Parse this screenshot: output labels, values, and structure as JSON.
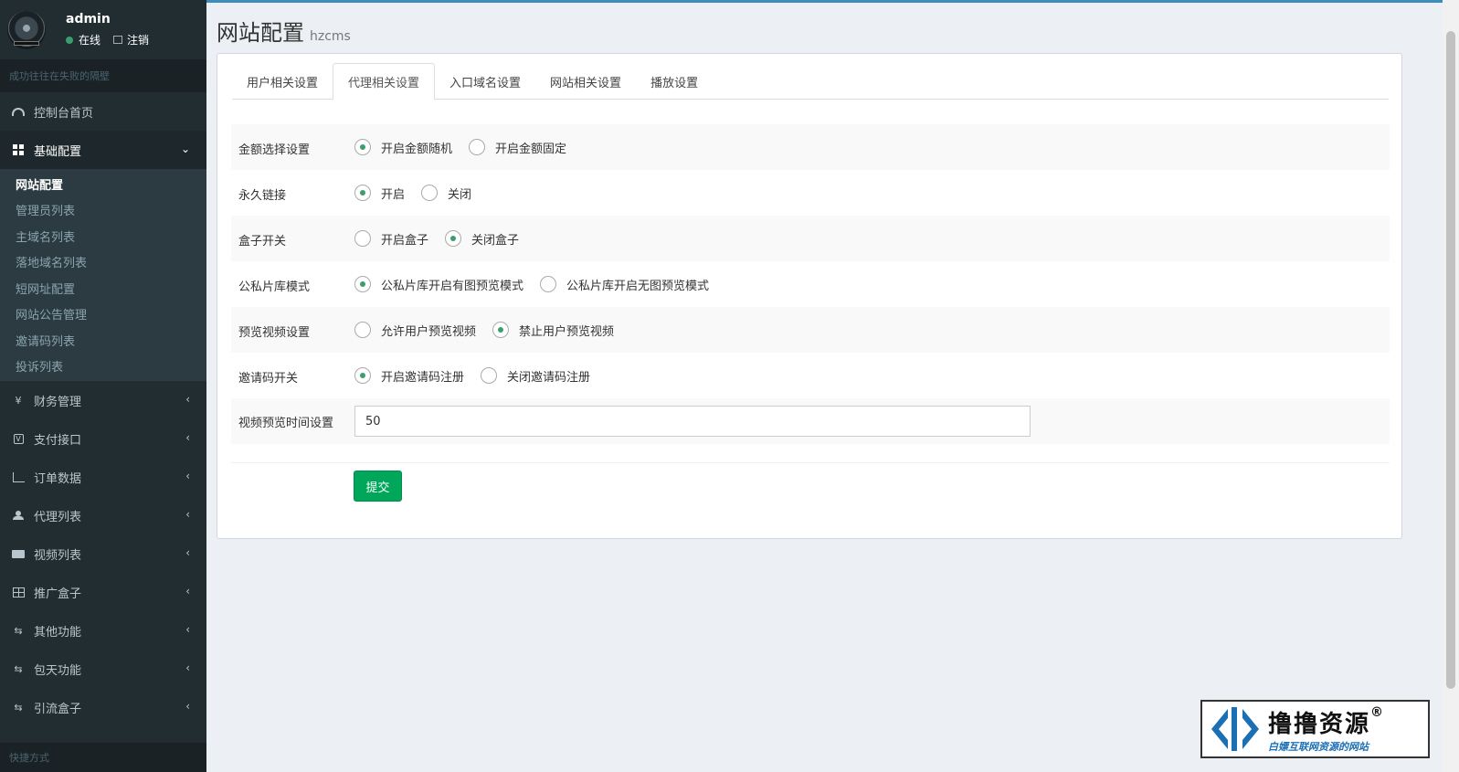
{
  "sidebar": {
    "user": {
      "name": "admin",
      "status": "在线",
      "logout": "注销"
    },
    "search_placeholder": "成功往往在失败的隔壁",
    "menu": [
      {
        "label": "控制台首页",
        "icon": "dashboard-icon"
      },
      {
        "label": "基础配置",
        "icon": "grid-icon",
        "expanded": true,
        "children": [
          "网站配置",
          "管理员列表",
          "主域名列表",
          "落地域名列表",
          "短网址配置",
          "网站公告管理",
          "邀请码列表",
          "投诉列表"
        ]
      },
      {
        "label": "财务管理",
        "icon": "yen-icon"
      },
      {
        "label": "支付接口",
        "icon": "v-icon"
      },
      {
        "label": "订单数据",
        "icon": "bar-chart-icon"
      },
      {
        "label": "代理列表",
        "icon": "users-icon"
      },
      {
        "label": "视频列表",
        "icon": "video-icon"
      },
      {
        "label": "推广盒子",
        "icon": "table-icon"
      },
      {
        "label": "其他功能",
        "icon": "retweet-icon"
      },
      {
        "label": "包天功能",
        "icon": "retweet-icon"
      },
      {
        "label": "引流盒子",
        "icon": "retweet-icon"
      }
    ],
    "footer": "快捷方式"
  },
  "header": {
    "title": "网站配置",
    "subtitle": "hzcms"
  },
  "tabs": [
    "用户相关设置",
    "代理相关设置",
    "入口域名设置",
    "网站相关设置",
    "播放设置"
  ],
  "active_tab": 1,
  "form": {
    "rows": [
      {
        "label": "金额选择设置",
        "options": [
          "开启金额随机",
          "开启金额固定"
        ],
        "selected": 0
      },
      {
        "label": "永久链接",
        "options": [
          "开启",
          "关闭"
        ],
        "selected": 0
      },
      {
        "label": "盒子开关",
        "options": [
          "开启盒子",
          "关闭盒子"
        ],
        "selected": 1
      },
      {
        "label": "公私片库模式",
        "options": [
          "公私片库开启有图预览模式",
          "公私片库开启无图预览模式"
        ],
        "selected": 0
      },
      {
        "label": "预览视频设置",
        "options": [
          "允许用户预览视频",
          "禁止用户预览视频"
        ],
        "selected": 1
      },
      {
        "label": "邀请码开关",
        "options": [
          "开启邀请码注册",
          "关闭邀请码注册"
        ],
        "selected": 0
      }
    ],
    "preview_time": {
      "label": "视频预览时间设置",
      "value": "50"
    },
    "submit": "提交"
  },
  "watermark": {
    "title": "撸撸资源",
    "reg": "®",
    "sub": "白嫖互联网资源的网站"
  },
  "colors": {
    "sidebar_bg": "#222d32",
    "accent": "#3c8dbc",
    "success": "#00a65a",
    "radio_dot": "#3c9d6d"
  }
}
